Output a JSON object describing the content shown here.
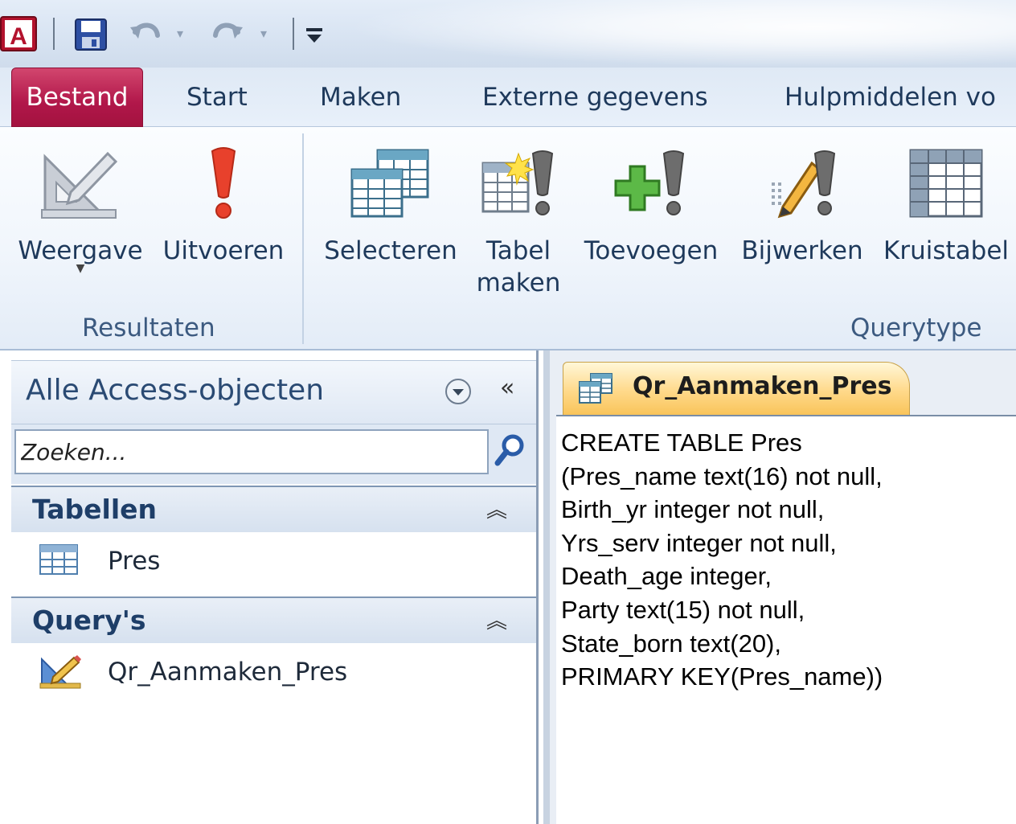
{
  "tabs": {
    "file": "Bestand",
    "start": "Start",
    "make": "Maken",
    "external": "Externe gegevens",
    "tools": "Hulpmiddelen vo"
  },
  "ribbon": {
    "results_group_label": "Resultaten",
    "querytype_group_label": "Querytype",
    "view": "Weergave",
    "run": "Uitvoeren",
    "select": "Selecteren",
    "make_table_line1": "Tabel",
    "make_table_line2": "maken",
    "append": "Toevoegen",
    "update": "Bijwerken",
    "crosstab": "Kruistabel"
  },
  "nav": {
    "title": "Alle Access-objecten",
    "search_placeholder": "Zoeken...",
    "groups": [
      {
        "title": "Tabellen",
        "items": [
          {
            "label": "Pres",
            "icon": "table-icon"
          }
        ]
      },
      {
        "title": "Query's",
        "items": [
          {
            "label": "Qr_Aanmaken_Pres",
            "icon": "query-design-icon"
          }
        ]
      }
    ]
  },
  "document": {
    "tab_title": "Qr_Aanmaken_Pres",
    "sql_lines": [
      "CREATE TABLE Pres",
      "(Pres_name text(16) not null,",
      "Birth_yr integer not null,",
      "Yrs_serv integer not null,",
      "Death_age integer,",
      "Party text(15) not null,",
      "State_born text(20),",
      "PRIMARY KEY(Pres_name))"
    ]
  },
  "colors": {
    "file_tab": "#b1174a",
    "doc_tab": "#ffd98a",
    "ribbon_text": "#1e395b"
  }
}
